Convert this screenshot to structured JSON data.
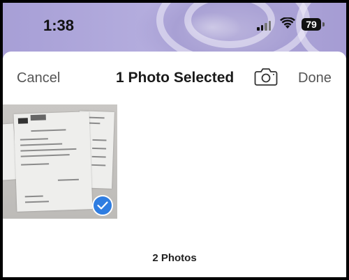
{
  "status_bar": {
    "time": "1:38",
    "battery_level": "79"
  },
  "picker": {
    "cancel_label": "Cancel",
    "title": "1 Photo Selected",
    "camera_icon": "camera-icon",
    "done_label": "Done",
    "photo_count": "2 Photos"
  },
  "thumbnails": [
    {
      "selected": true,
      "check_icon": "checkmark-icon",
      "accent": "#2f7de1"
    }
  ]
}
